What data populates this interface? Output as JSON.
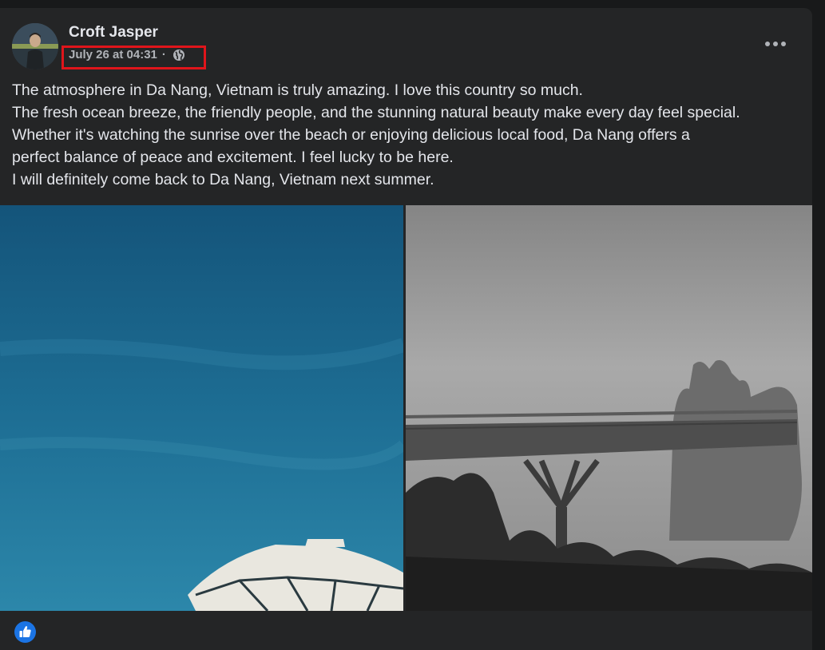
{
  "post": {
    "author": "Croft Jasper",
    "timestamp": "July 26 at 04:31",
    "separator": "·",
    "privacy_icon": "globe-icon",
    "text_lines": [
      "The atmosphere in Da Nang, Vietnam is truly amazing. I love this country so much.",
      "The fresh ocean breeze, the friendly people, and the stunning natural beauty make every day feel special.",
      "Whether it's watching the sunrise over the beach or enjoying delicious local food, Da Nang offers a",
      "perfect balance of peace and excitement. I feel lucky to be here.",
      "I will definitely come back to Da Nang, Vietnam next summer."
    ],
    "more_icon": "more-options-icon",
    "photos": [
      "beach-umbrella-sky-photo",
      "golden-bridge-hands-photo"
    ],
    "reaction_icon": "like-icon"
  },
  "colors": {
    "background": "#18191a",
    "card": "#242526",
    "primary_text": "#e4e6eb",
    "secondary_text": "#b0b3b8",
    "highlight": "#e0151b",
    "like_blue": "#1b74e4"
  }
}
